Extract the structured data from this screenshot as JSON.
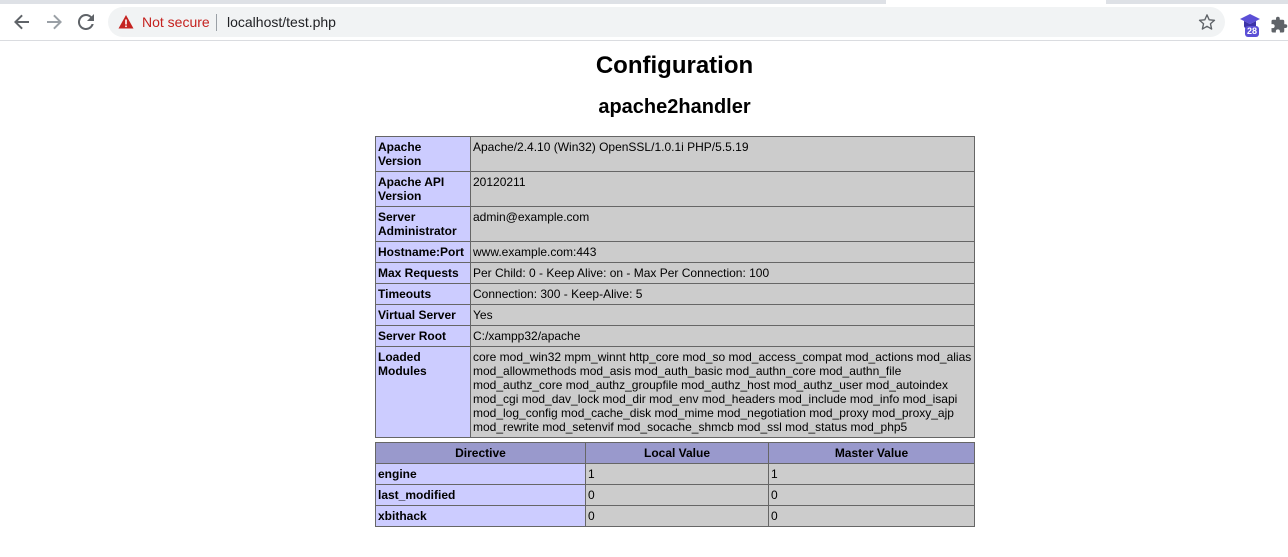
{
  "browser": {
    "security_label": "Not secure",
    "url": "localhost/test.php",
    "extension_badge": "28"
  },
  "page": {
    "title": "Configuration",
    "subtitle": "apache2handler"
  },
  "apache_table": {
    "rows": [
      {
        "key": "Apache Version",
        "value": "Apache/2.4.10 (Win32) OpenSSL/1.0.1i PHP/5.5.19"
      },
      {
        "key": "Apache API Version",
        "value": "20120211"
      },
      {
        "key": "Server Administrator",
        "value": "admin@example.com"
      },
      {
        "key": "Hostname:Port",
        "value": "www.example.com:443"
      },
      {
        "key": "Max Requests",
        "value": "Per Child: 0 - Keep Alive: on - Max Per Connection: 100"
      },
      {
        "key": "Timeouts",
        "value": "Connection: 300 - Keep-Alive: 5"
      },
      {
        "key": "Virtual Server",
        "value": "Yes"
      },
      {
        "key": "Server Root",
        "value": "C:/xampp32/apache"
      },
      {
        "key": "Loaded Modules",
        "value": "core mod_win32 mpm_winnt http_core mod_so mod_access_compat mod_actions mod_alias mod_allowmethods mod_asis mod_auth_basic mod_authn_core mod_authn_file mod_authz_core mod_authz_groupfile mod_authz_host mod_authz_user mod_autoindex mod_cgi mod_dav_lock mod_dir mod_env mod_headers mod_include mod_info mod_isapi mod_log_config mod_cache_disk mod_mime mod_negotiation mod_proxy mod_proxy_ajp mod_rewrite mod_setenvif mod_socache_shmcb mod_ssl mod_status mod_php5"
      }
    ]
  },
  "directive_table": {
    "headers": [
      "Directive",
      "Local Value",
      "Master Value"
    ],
    "rows": [
      {
        "directive": "engine",
        "local": "1",
        "master": "1"
      },
      {
        "directive": "last_modified",
        "local": "0",
        "master": "0"
      },
      {
        "directive": "xbithack",
        "local": "0",
        "master": "0"
      }
    ]
  }
}
